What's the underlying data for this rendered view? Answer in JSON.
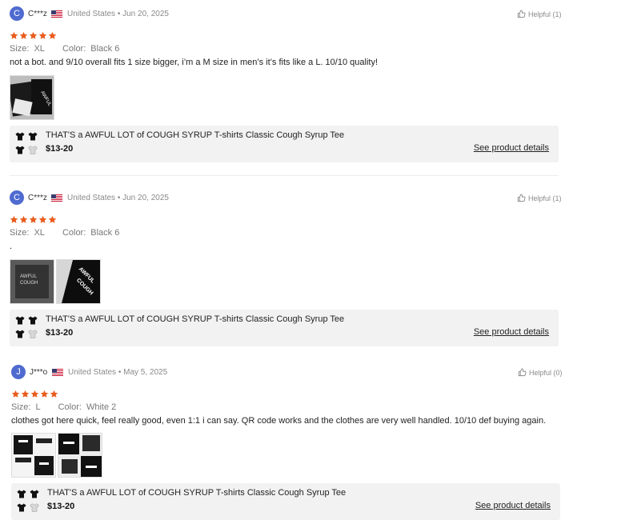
{
  "colors": {
    "star": "#e85d1f",
    "avatar": "#4f6bd0",
    "card_bg": "#f2f2f2"
  },
  "reviews": [
    {
      "avatar_letter": "C",
      "username": "C***z",
      "country": "United States",
      "date": "Jun 20, 2025",
      "helpful": "Helpful (1)",
      "rating": 5,
      "size_label": "Size:",
      "size_value": "XL",
      "color_label": "Color:",
      "color_value": "Black 6",
      "text": "not a bot. and 9/10 overall fits 1 size bigger, i’m a M size in men’s it’s fits like a L. 10/10 quality!",
      "product_title": "THAT'S a AWFUL LOT of COUGH SYRUP T-shirts Classic Cough Syrup Tee",
      "price": "$13-20",
      "details_link": "See product details"
    },
    {
      "avatar_letter": "C",
      "username": "C***z",
      "country": "United States",
      "date": "Jun 20, 2025",
      "helpful": "Helpful (1)",
      "rating": 5,
      "size_label": "Size:",
      "size_value": "XL",
      "color_label": "Color:",
      "color_value": "Black 6",
      "text": ".",
      "product_title": "THAT'S a AWFUL LOT of COUGH SYRUP T-shirts Classic Cough Syrup Tee",
      "price": "$13-20",
      "details_link": "See product details"
    },
    {
      "avatar_letter": "J",
      "username": "J***o",
      "country": "United States",
      "date": "May 5, 2025",
      "helpful": "Helpful (0)",
      "rating": 5,
      "size_label": "Size:",
      "size_value": "L",
      "color_label": "Color:",
      "color_value": "White 2",
      "text": "clothes got here quick, feel really good, even 1:1 i can say. QR code works and the clothes are very well handled. 10/10 def buying again.",
      "product_title": "THAT'S a AWFUL LOT of COUGH SYRUP T-shirts Classic Cough Syrup Tee",
      "price": "$13-20",
      "details_link": "See product details"
    }
  ]
}
